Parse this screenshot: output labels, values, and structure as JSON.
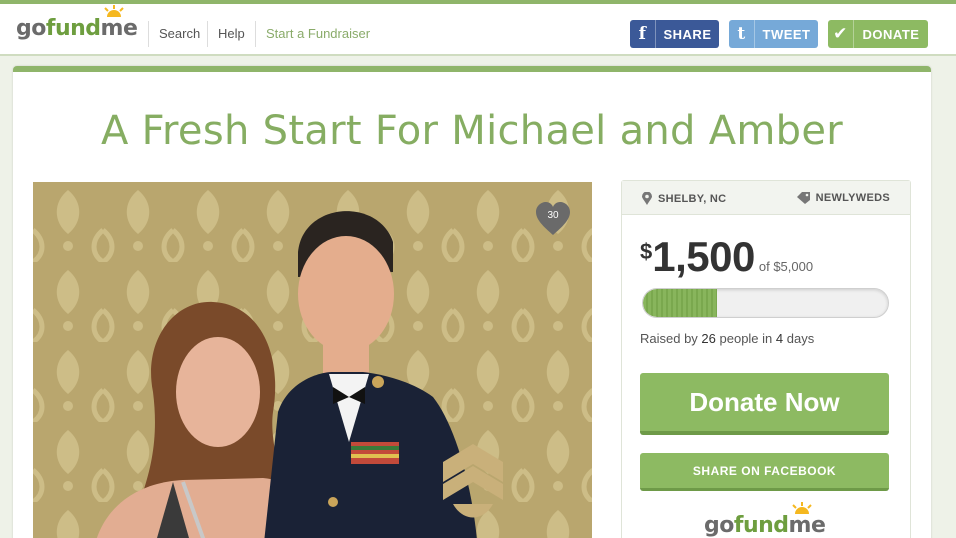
{
  "colors": {
    "brand_green": "#8fb56a",
    "facebook_blue": "#3b5998",
    "twitter_blue": "#76a9d8",
    "title_green": "#86ad62"
  },
  "header": {
    "logo": {
      "go": "go",
      "fund": "fund",
      "me": "me"
    },
    "nav": {
      "search": "Search",
      "help": "Help",
      "start": "Start a Fundraiser"
    },
    "share": {
      "icon": "f",
      "label": "SHARE"
    },
    "tweet": {
      "icon": "t",
      "label": "TWEET"
    },
    "donate": {
      "icon": "✔",
      "label": "DONATE"
    }
  },
  "campaign": {
    "title": "A Fresh Start For Michael and Amber",
    "favorites_count": "30",
    "location": "SHELBY, NC",
    "category": "NEWLYWEDS",
    "currency": "$",
    "raised_amount": "1,500",
    "goal_text": "of $5,000",
    "progress_fraction": 0.3,
    "people_prefix": "Raised by ",
    "people_count": "26",
    "people_middle": " people in ",
    "days_count": "4",
    "days_suffix": " days",
    "donate_label": "Donate Now",
    "facebook_share_label": "SHARE ON FACEBOOK"
  }
}
